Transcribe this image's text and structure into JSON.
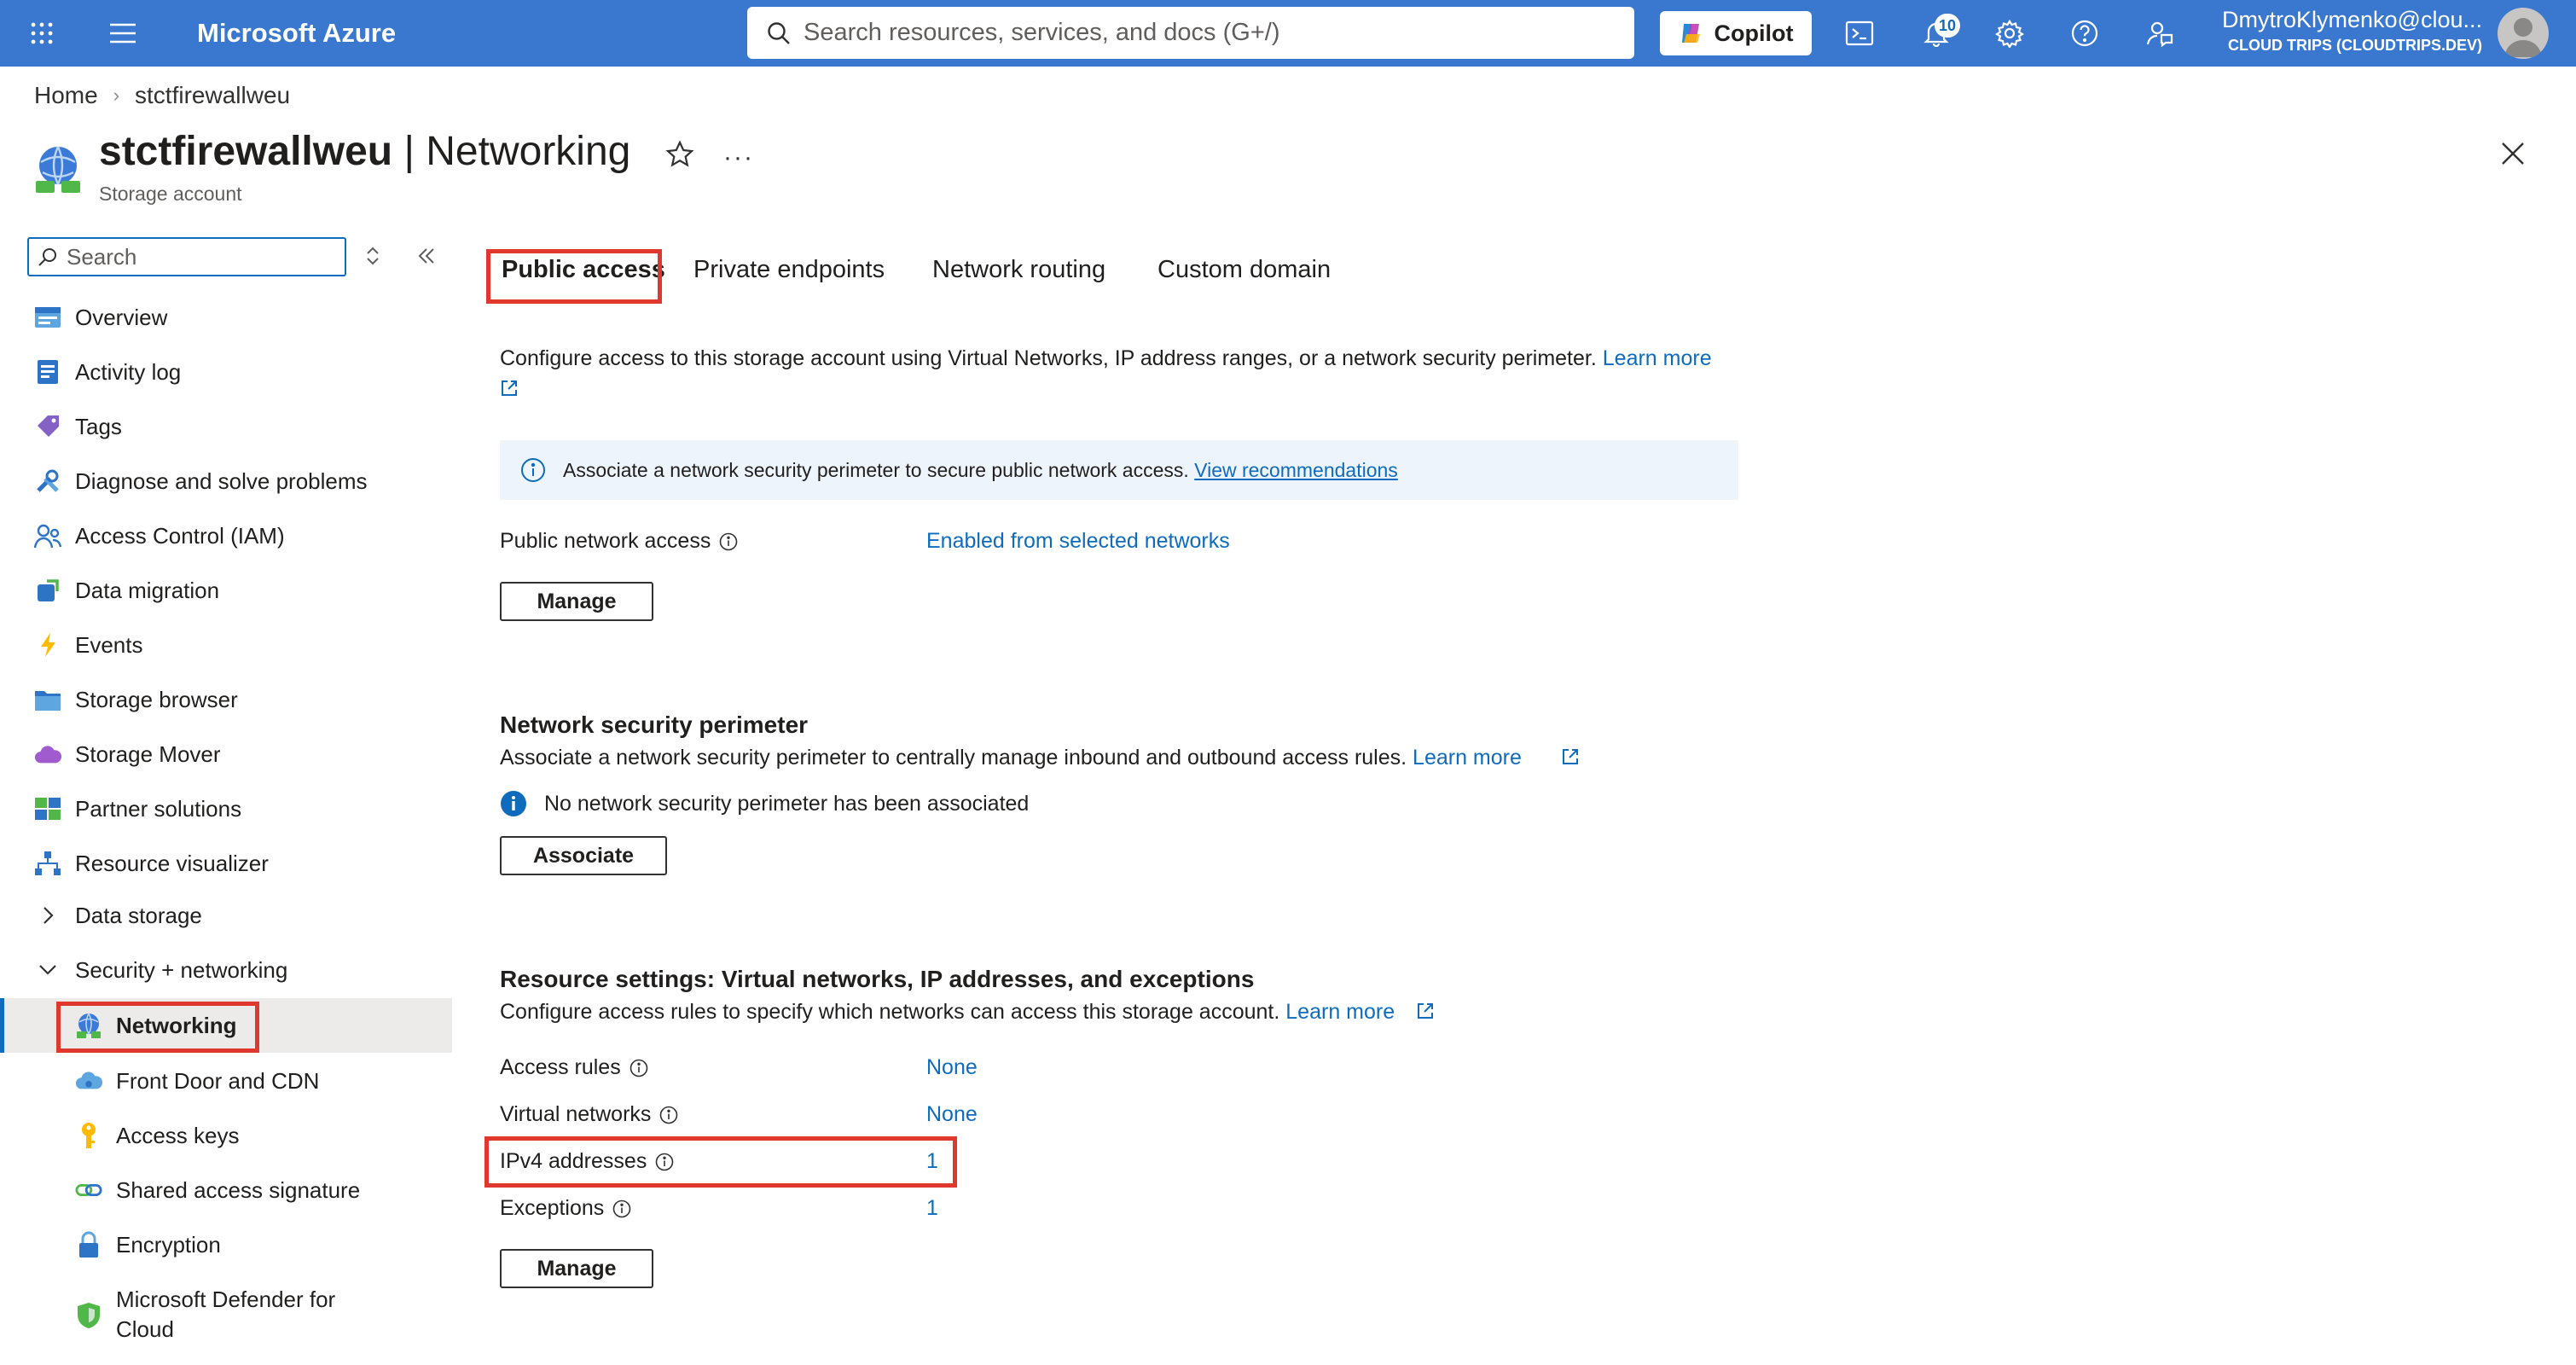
{
  "topbar": {
    "brand": "Microsoft Azure",
    "search_placeholder": "Search resources, services, and docs (G+/)",
    "copilot_label": "Copilot",
    "notifications_count": "10",
    "user_name": "DmytroKlymenko@clou...",
    "user_tenant": "CLOUD TRIPS (CLOUDTRIPS.DEV)"
  },
  "breadcrumb": {
    "home": "Home",
    "current": "stctfirewallweu"
  },
  "header": {
    "resource_name": "stctfirewallweu",
    "page_name": "| Networking",
    "subtitle": "Storage account"
  },
  "sidebar": {
    "search_placeholder": "Search",
    "items": [
      {
        "label": "Overview",
        "icon": "overview-icon"
      },
      {
        "label": "Activity log",
        "icon": "activity-log-icon"
      },
      {
        "label": "Tags",
        "icon": "tag-icon"
      },
      {
        "label": "Diagnose and solve problems",
        "icon": "wrench-icon"
      },
      {
        "label": "Access Control (IAM)",
        "icon": "people-icon"
      },
      {
        "label": "Data migration",
        "icon": "migration-icon"
      },
      {
        "label": "Events",
        "icon": "lightning-icon"
      },
      {
        "label": "Storage browser",
        "icon": "folder-icon"
      },
      {
        "label": "Storage Mover",
        "icon": "cloud-icon"
      },
      {
        "label": "Partner solutions",
        "icon": "partner-icon"
      },
      {
        "label": "Resource visualizer",
        "icon": "hierarchy-icon"
      },
      {
        "label": "Data storage",
        "icon": "chevron-right-icon"
      },
      {
        "label": "Security + networking",
        "icon": "chevron-down-icon"
      },
      {
        "label": "Networking",
        "icon": "networking-icon"
      },
      {
        "label": "Front Door and CDN",
        "icon": "cloud-cdn-icon"
      },
      {
        "label": "Access keys",
        "icon": "key-icon"
      },
      {
        "label": "Shared access signature",
        "icon": "link-icon"
      },
      {
        "label": "Encryption",
        "icon": "lock-icon"
      },
      {
        "label": "Microsoft Defender for",
        "label2": "Cloud",
        "icon": "shield-icon"
      }
    ]
  },
  "tabs": [
    "Public access",
    "Private endpoints",
    "Network routing",
    "Custom domain"
  ],
  "intro": {
    "text": "Configure access to this storage account using Virtual Networks, IP address ranges, or a network security perimeter.",
    "learn_more": "Learn more"
  },
  "banner": {
    "text": "Associate a network security perimeter to secure public network access.",
    "link": "View recommendations"
  },
  "public_network": {
    "label": "Public network access",
    "value": "Enabled from selected networks",
    "button": "Manage"
  },
  "nsp": {
    "title": "Network security perimeter",
    "description": "Associate a network security perimeter to centrally manage inbound and outbound access rules.",
    "learn_more": "Learn more",
    "status": "No network security perimeter has been associated",
    "button": "Associate"
  },
  "resource_settings": {
    "title": "Resource settings: Virtual networks, IP addresses, and exceptions",
    "description": "Configure access rules to specify which networks can access this storage account.",
    "learn_more": "Learn more",
    "rows": [
      {
        "label": "Access rules",
        "value": "None"
      },
      {
        "label": "Virtual networks",
        "value": "None"
      },
      {
        "label": "IPv4 addresses",
        "value": "1"
      },
      {
        "label": "Exceptions",
        "value": "1"
      }
    ],
    "button": "Manage"
  },
  "colors": {
    "topbar": "#3a78cf",
    "link": "#0f6cbd",
    "highlight": "#e0382e",
    "banner": "#eef4fc"
  }
}
